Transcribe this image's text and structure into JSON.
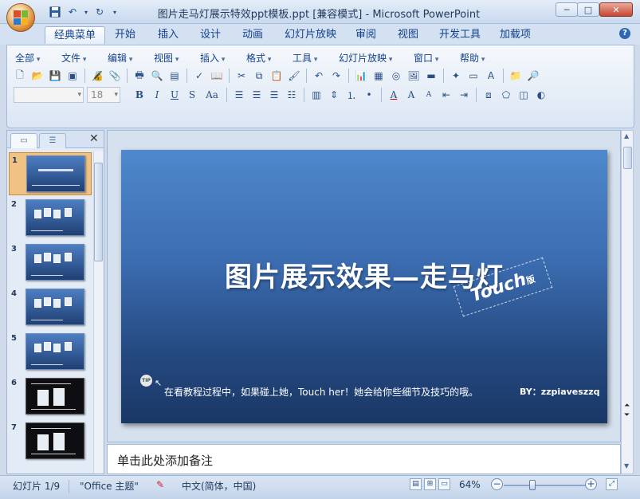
{
  "titlebar": {
    "title": "图片走马灯展示特效ppt模板.ppt [兼容模式] - Microsoft PowerPoint",
    "qat": [
      "save-icon",
      "undo-icon",
      "redo-icon"
    ],
    "controls": {
      "minimize": "─",
      "maximize": "□",
      "close": "✕"
    }
  },
  "tabs": [
    "经典菜单",
    "开始",
    "插入",
    "设计",
    "动画",
    "幻灯片放映",
    "审阅",
    "视图",
    "开发工具",
    "加载项"
  ],
  "active_tab": "经典菜单",
  "help": "?",
  "menus": [
    "全部",
    "文件",
    "编辑",
    "视图",
    "插入",
    "格式",
    "工具",
    "幻灯片放映",
    "窗口",
    "帮助"
  ],
  "toolbar": {
    "font_name": "",
    "font_size": "18",
    "bold": "B",
    "italic": "I",
    "underline": "U",
    "shadow": "S",
    "case": "Aa",
    "font_color": "A",
    "grow": "A",
    "shrink": "A"
  },
  "slides_pane": {
    "close": "✕",
    "slides": [
      {
        "num": "1",
        "style": "blue",
        "selected": true
      },
      {
        "num": "2",
        "style": "blue"
      },
      {
        "num": "3",
        "style": "blue"
      },
      {
        "num": "4",
        "style": "blue"
      },
      {
        "num": "5",
        "style": "blue"
      },
      {
        "num": "6",
        "style": "dark"
      },
      {
        "num": "7",
        "style": "dark"
      }
    ]
  },
  "slide": {
    "title": "图片展示效果—走马灯",
    "stamp": "Touch",
    "stamp_suffix": "版",
    "tip_badge": "TIP",
    "tip": "在看教程过程中，如果碰上她，Touch her！她会给你些细节及技巧的哦。",
    "byline": "BY：zzpiaveszzq"
  },
  "notes": {
    "placeholder": "单击此处添加备注"
  },
  "status": {
    "slide_info": "幻灯片 1/9",
    "theme": "\"Office 主题\"",
    "language": "中文(简体，中国)",
    "zoom": "64%",
    "zoom_level": 0.64
  },
  "colors": {
    "accent": "#15428b",
    "selected_thumb": "#f0c283",
    "slide_top": "#4f88cc",
    "slide_bottom": "#1a3766"
  }
}
